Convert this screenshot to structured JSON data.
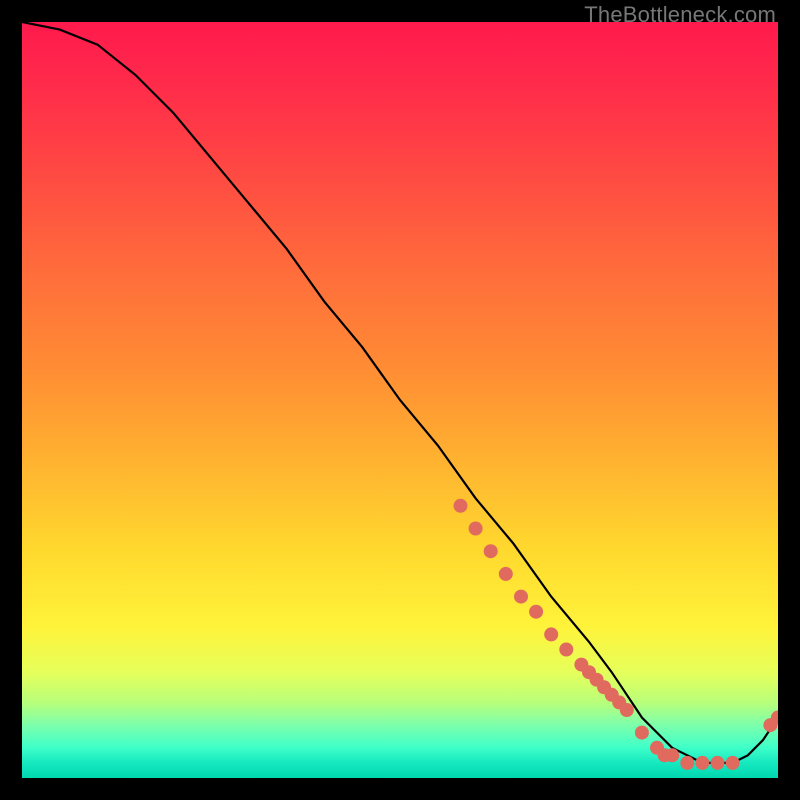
{
  "watermark": "TheBottleneck.com",
  "colors": {
    "gradient_top": "#ff1a4d",
    "gradient_bottom": "#00d8b0",
    "curve": "#000000",
    "marker": "#e06a5e",
    "frame": "#000000"
  },
  "chart_data": {
    "type": "line",
    "title": "",
    "xlabel": "",
    "ylabel": "",
    "xlim": [
      0,
      100
    ],
    "ylim": [
      0,
      100
    ],
    "grid": false,
    "series": [
      {
        "name": "bottleneck-curve",
        "x": [
          0,
          5,
          10,
          15,
          20,
          25,
          30,
          35,
          40,
          45,
          50,
          55,
          60,
          65,
          70,
          75,
          78,
          80,
          82,
          84,
          86,
          88,
          90,
          92,
          94,
          96,
          98,
          100
        ],
        "values": [
          100,
          99,
          97,
          93,
          88,
          82,
          76,
          70,
          63,
          57,
          50,
          44,
          37,
          31,
          24,
          18,
          14,
          11,
          8,
          6,
          4,
          3,
          2,
          2,
          2,
          3,
          5,
          8
        ]
      }
    ],
    "markers": {
      "name": "data-point-dots",
      "x": [
        58,
        60,
        62,
        64,
        66,
        68,
        70,
        72,
        74,
        75,
        76,
        77,
        78,
        79,
        80,
        82,
        84,
        85,
        86,
        88,
        90,
        92,
        94,
        99,
        100
      ],
      "values": [
        36,
        33,
        30,
        27,
        24,
        22,
        19,
        17,
        15,
        14,
        13,
        12,
        11,
        10,
        9,
        6,
        4,
        3,
        3,
        2,
        2,
        2,
        2,
        7,
        8
      ]
    },
    "annotations": []
  }
}
